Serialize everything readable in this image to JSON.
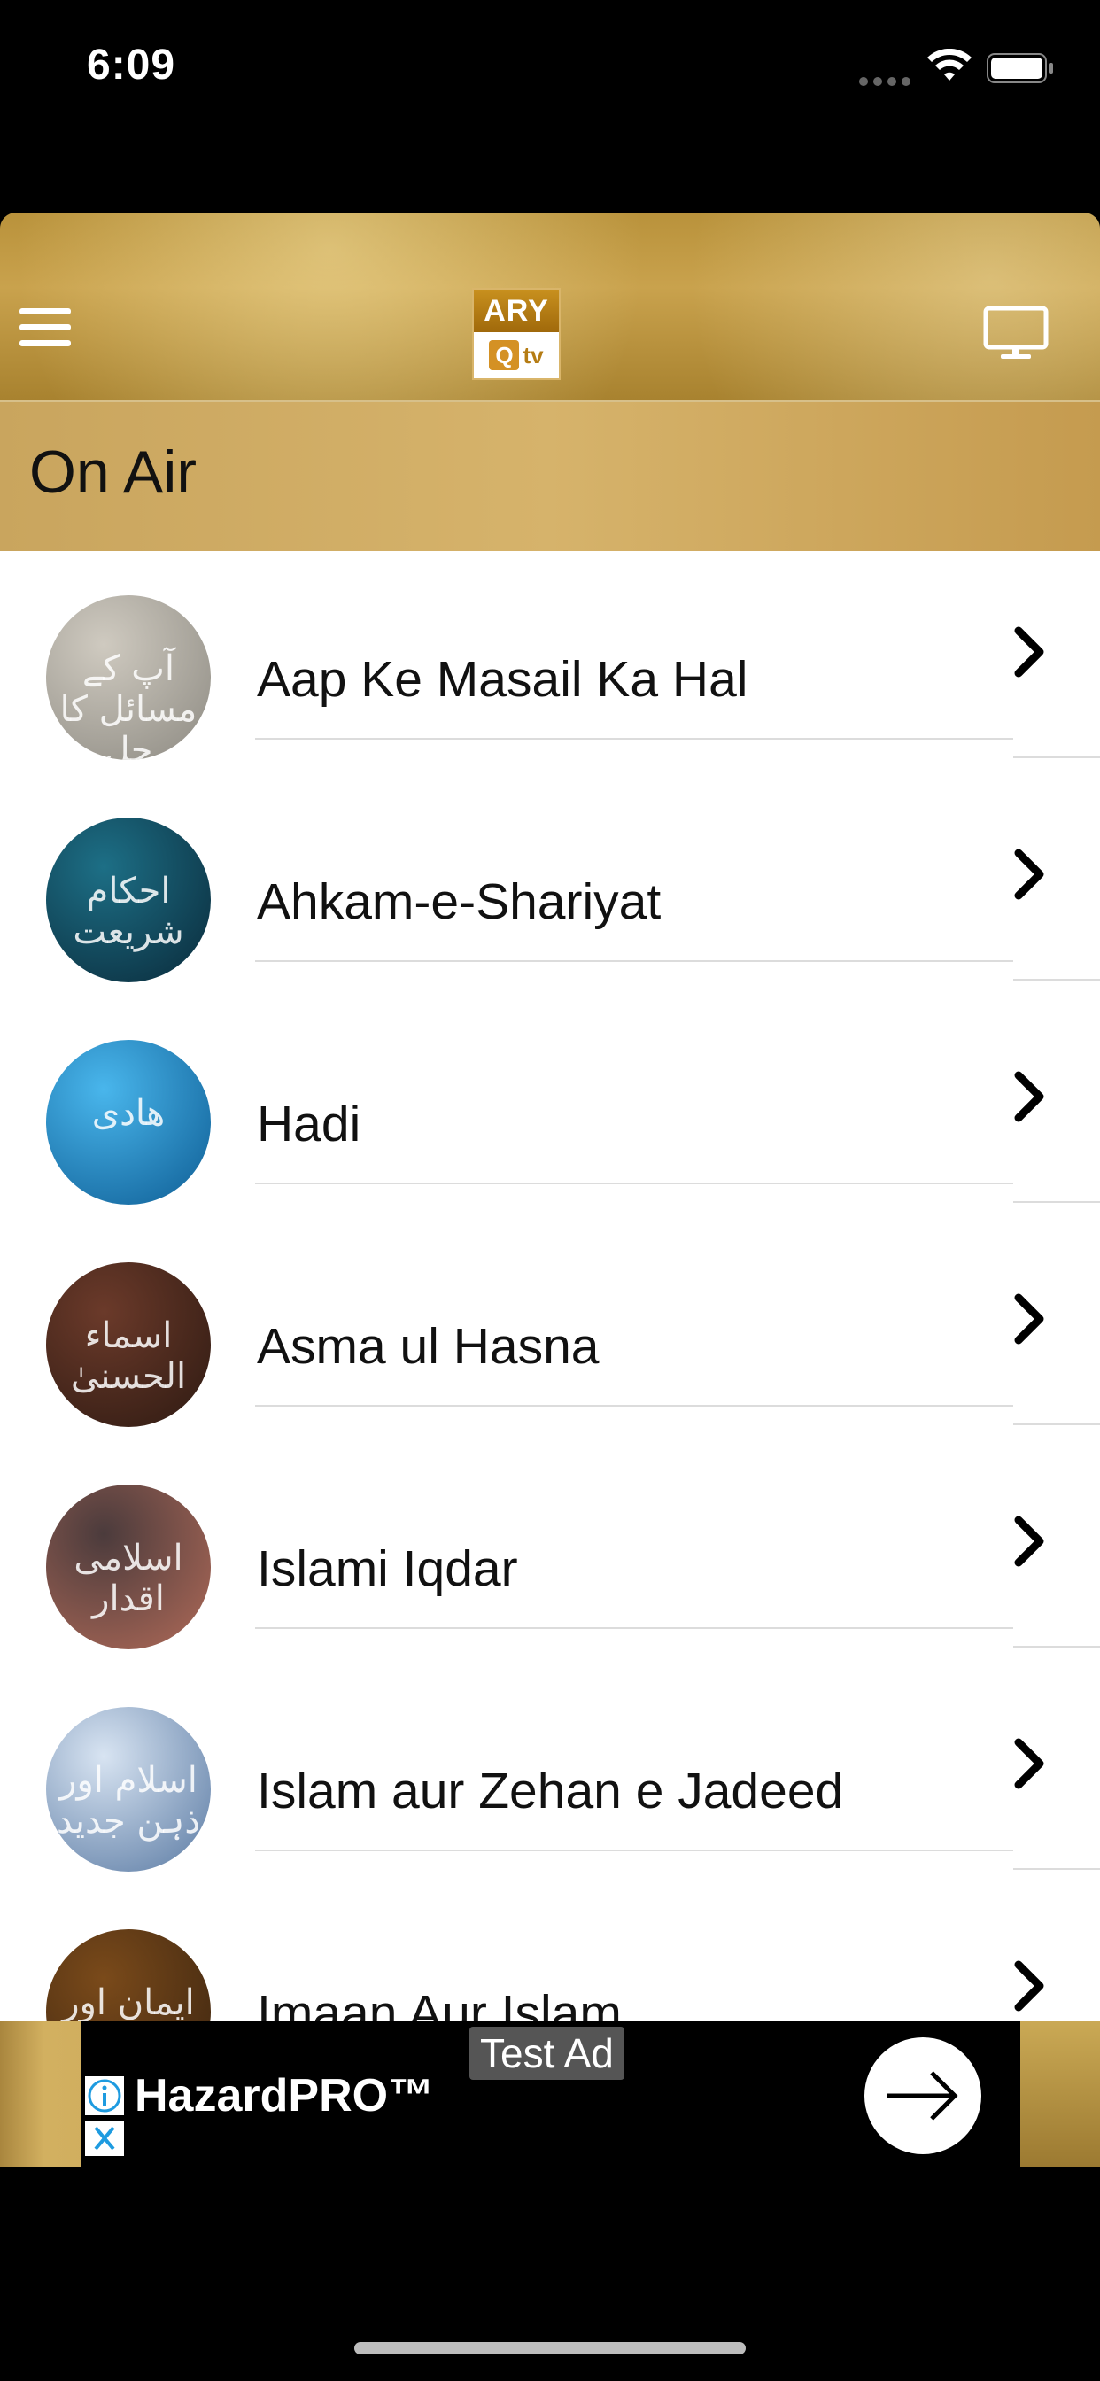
{
  "status_bar": {
    "time": "6:09"
  },
  "header": {
    "logo_top": "ARY",
    "logo_q": "Q",
    "logo_tv": "tv"
  },
  "section": {
    "title": "On Air"
  },
  "list": {
    "items": [
      {
        "label": "Aap Ke Masail Ka Hal",
        "thumb_text": "آپ کے مسائل کا حل",
        "thumb_colors": [
          "#cfcac0",
          "#8d8a82"
        ]
      },
      {
        "label": "Ahkam-e-Shariyat",
        "thumb_text": "احکام شریعت",
        "thumb_colors": [
          "#1d6f86",
          "#0a2a3a"
        ]
      },
      {
        "label": "Hadi",
        "thumb_text": "ھادی",
        "thumb_colors": [
          "#49b6ec",
          "#0e5d94"
        ]
      },
      {
        "label": "Asma ul Hasna",
        "thumb_text": "اسماء الحسنیٰ",
        "thumb_colors": [
          "#6b3a2a",
          "#2e1a12"
        ]
      },
      {
        "label": "Islami Iqdar",
        "thumb_text": "اسلامی اقدار",
        "thumb_colors": [
          "#4b3b3c",
          "#b06a58"
        ]
      },
      {
        "label": "Islam aur Zehan e Jadeed",
        "thumb_text": "اسلام اور ذہن جدید",
        "thumb_colors": [
          "#d8e4f2",
          "#5a7aa3"
        ]
      },
      {
        "label": "Imaan Aur Islam",
        "thumb_text": "ایمان اور اسلام",
        "thumb_colors": [
          "#7a4a1a",
          "#3b2410"
        ]
      }
    ]
  },
  "ad": {
    "test_label": "Test Ad",
    "title": "HazardPRO™"
  }
}
